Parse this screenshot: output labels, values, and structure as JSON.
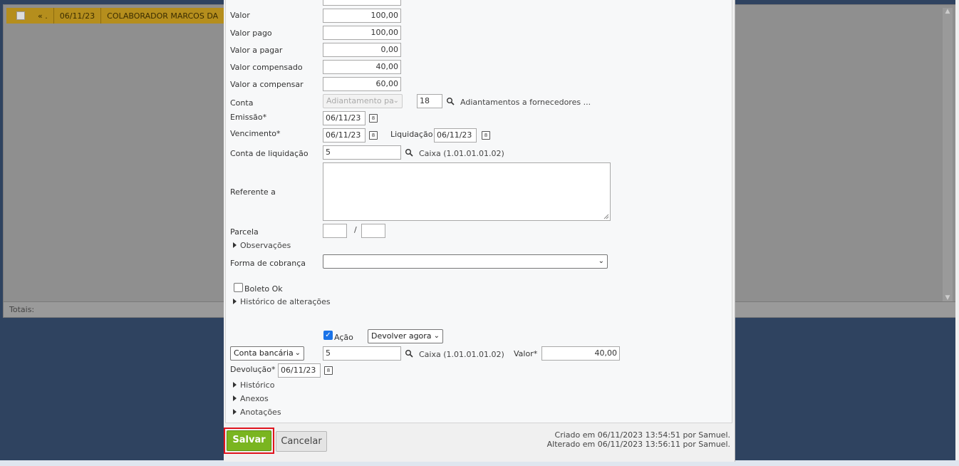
{
  "background": {
    "row": {
      "date": "06/11/23",
      "name": "COLABORADOR MARCOS DA",
      "flag": "« ."
    },
    "totals_label": "Totais:"
  },
  "form": {
    "valor": {
      "label": "Valor",
      "value": "100,00"
    },
    "valor_pago": {
      "label": "Valor pago",
      "value": "100,00"
    },
    "valor_a_pagar": {
      "label": "Valor a pagar",
      "value": "0,00"
    },
    "valor_compensado": {
      "label": "Valor compensado",
      "value": "40,00"
    },
    "valor_a_compensar": {
      "label": "Valor a compensar",
      "value": "60,00"
    },
    "conta": {
      "label": "Conta",
      "select_value": "Adiantamento pa",
      "code": "18",
      "description": "Adiantamentos a fornecedores ..."
    },
    "emissao": {
      "label": "Emissão*",
      "value": "06/11/23"
    },
    "vencimento": {
      "label": "Vencimento*",
      "value": "06/11/23"
    },
    "liquidacao": {
      "label": "Liquidação",
      "value": "06/11/23"
    },
    "conta_liquidacao": {
      "label": "Conta de liquidação",
      "value": "5",
      "description": "Caixa (1.01.01.01.02)"
    },
    "referente_a": {
      "label": "Referente a",
      "value": ""
    },
    "parcela": {
      "label": "Parcela",
      "value1": "",
      "slash": "/",
      "value2": ""
    },
    "observacoes_label": "Observações",
    "forma_cobranca": {
      "label": "Forma de cobrança",
      "value": ""
    },
    "boleto_ok_label": "Boleto Ok",
    "historico_alteracoes_label": "Histórico de alterações",
    "acao": {
      "label": "Ação",
      "select_value": "Devolver agora"
    },
    "conta_bancaria": {
      "select_value": "Conta bancária",
      "value": "5",
      "description": "Caixa (1.01.01.01.02)"
    },
    "valor_devolucao": {
      "label": "Valor*",
      "value": "40,00"
    },
    "devolucao": {
      "label": "Devolução*",
      "value": "06/11/23"
    },
    "historico_label": "Histórico",
    "anexos_label": "Anexos",
    "anotacoes_label": "Anotações"
  },
  "footer": {
    "save_label": "Salvar",
    "cancel_label": "Cancelar",
    "created": "Criado em 06/11/2023 13:54:51 por Samuel.",
    "modified": "Alterado em 06/11/2023 13:56:11 por Samuel."
  },
  "colors": {
    "save_button": "#7ab520",
    "highlight_border": "#e0141e",
    "backdrop": "#2f4360",
    "selected_row": "#b58e1d"
  }
}
